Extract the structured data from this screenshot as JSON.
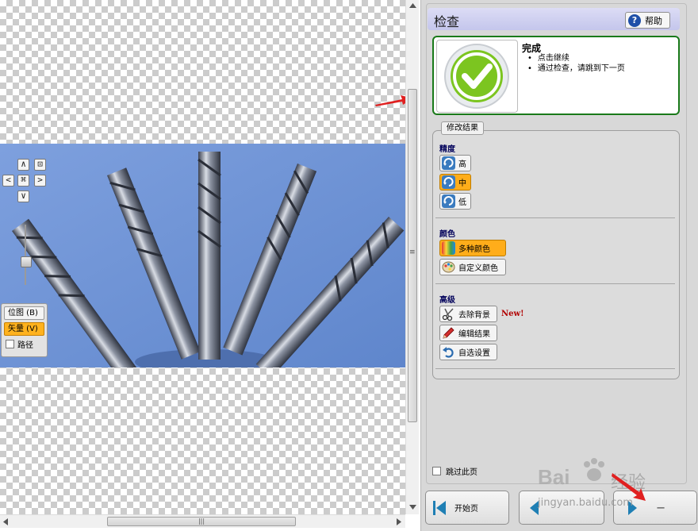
{
  "canvas": {
    "nav": {
      "up": "∧",
      "fit": "⊡",
      "left": "<",
      "center": "⌘",
      "right": ">",
      "down": "∨"
    },
    "mode_buttons": [
      {
        "label": "位图 (B)",
        "active": false
      },
      {
        "label": "矢量 (V)",
        "active": true
      }
    ],
    "path_checkbox_label": "路径",
    "hscroll_grip": "|||",
    "vscroll_grip": "≡"
  },
  "panel": {
    "title": "检查",
    "help_label": "帮助",
    "status": {
      "title": "完成",
      "items": [
        "点击继续",
        "通过检查，请跳到下一页"
      ],
      "accent": "#1a7a1a"
    },
    "group_title": "修改结果",
    "precision": {
      "title": "精度",
      "options": [
        {
          "label": "高",
          "active": false
        },
        {
          "label": "中",
          "active": true
        },
        {
          "label": "低",
          "active": false
        }
      ]
    },
    "color": {
      "title": "颜色",
      "options": [
        {
          "label": "多种颜色",
          "active": true,
          "icon": "rainbow-icon"
        },
        {
          "label": "自定义颜色",
          "active": false,
          "icon": "palette-icon"
        }
      ]
    },
    "advanced": {
      "title": "高级",
      "options": [
        {
          "label": "去除背景",
          "icon": "scissors-icon"
        },
        {
          "label": "编辑结果",
          "icon": "pencil-icon"
        },
        {
          "label": "自选设置",
          "icon": "undo-icon"
        }
      ],
      "new_tag": "New!"
    },
    "skip_label": "跳过此页",
    "footer": {
      "start_label": "开始页",
      "prev_label": "",
      "next_label": "一"
    }
  },
  "watermark": {
    "brand": "Bai",
    "brand2": "经验",
    "url": "jingyan.baidu.com"
  },
  "colors": {
    "highlight": "#ffad1a",
    "header": "#c4c6ec",
    "photo_bg": "#7094d4"
  }
}
